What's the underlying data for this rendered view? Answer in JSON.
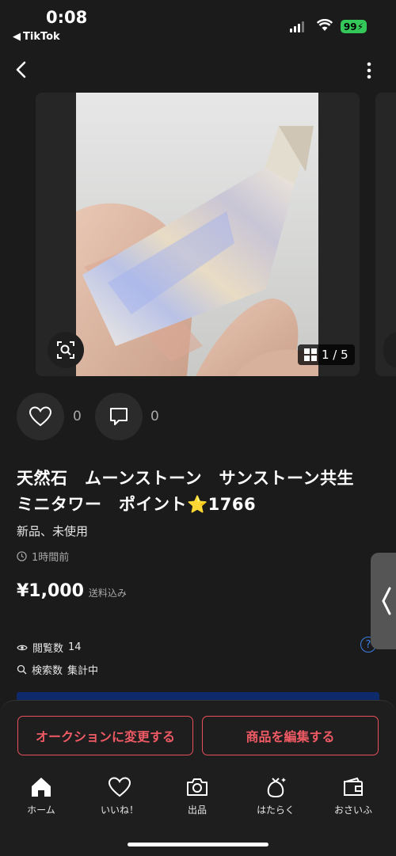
{
  "status_bar": {
    "time": "0:08",
    "back_app": "TikTok",
    "battery": "99"
  },
  "gallery": {
    "counter": "1 / 5"
  },
  "social": {
    "like_count": "0",
    "comment_count": "0"
  },
  "item": {
    "title": "天然石　ムーンストーン　サンストーン共生　ミニタワー　ポイント⭐1766",
    "condition": "新品、未使用",
    "posted": "1時間前",
    "price": "¥1,000",
    "shipping": "送料込み"
  },
  "stats": {
    "views_label": "閲覧数",
    "views_value": "14",
    "search_label": "検索数",
    "search_value": "集計中"
  },
  "actions": {
    "auction": "オークションに変更する",
    "edit": "商品を編集する"
  },
  "tabs": [
    {
      "label": "ホーム",
      "icon": "home-icon"
    },
    {
      "label": "いいね！",
      "icon": "heart-icon"
    },
    {
      "label": "出品",
      "icon": "camera-icon"
    },
    {
      "label": "はたらく",
      "icon": "bag-icon"
    },
    {
      "label": "おさいふ",
      "icon": "wallet-icon"
    }
  ],
  "colors": {
    "accent_red": "#ef5a64",
    "help_blue": "#3d7fe6",
    "battery_green": "#34c759"
  }
}
